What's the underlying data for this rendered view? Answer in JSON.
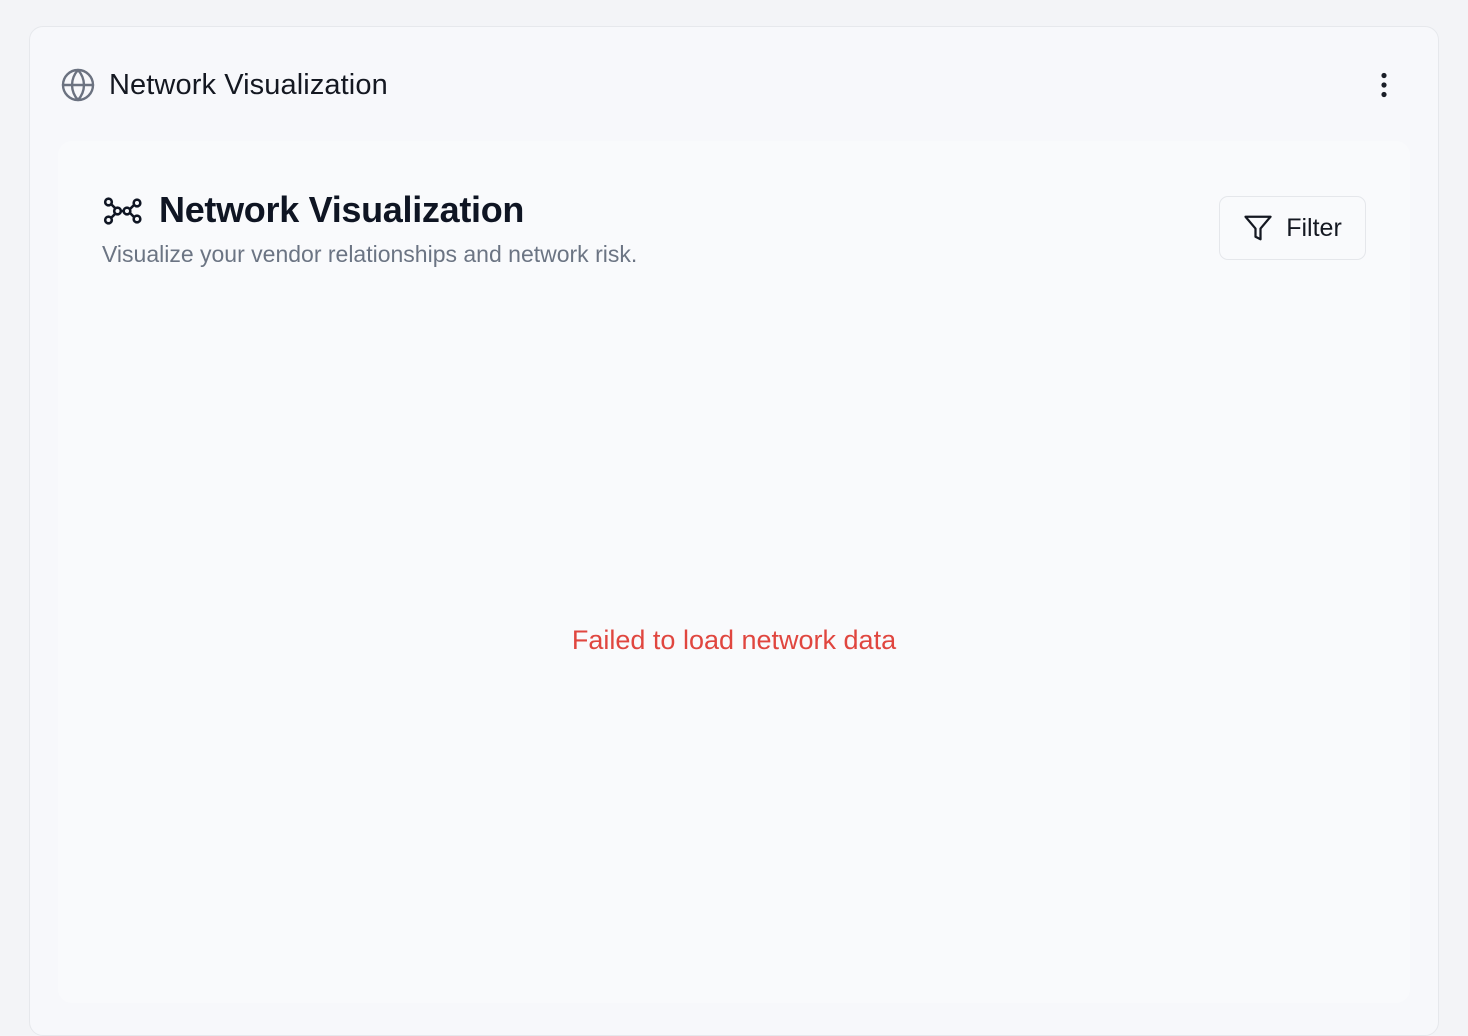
{
  "outer": {
    "title": "Network Visualization",
    "icon": "globe-icon",
    "menu_icon": "more-vertical-icon"
  },
  "panel": {
    "title": "Network Visualization",
    "subtitle": "Visualize your vendor relationships and network risk.",
    "icon": "network-icon",
    "filter_label": "Filter",
    "filter_icon": "filter-icon"
  },
  "status": {
    "error": "Failed to load network data"
  },
  "colors": {
    "error": "#e0463f",
    "title": "#0f1523",
    "subtitle": "#6b7483"
  }
}
